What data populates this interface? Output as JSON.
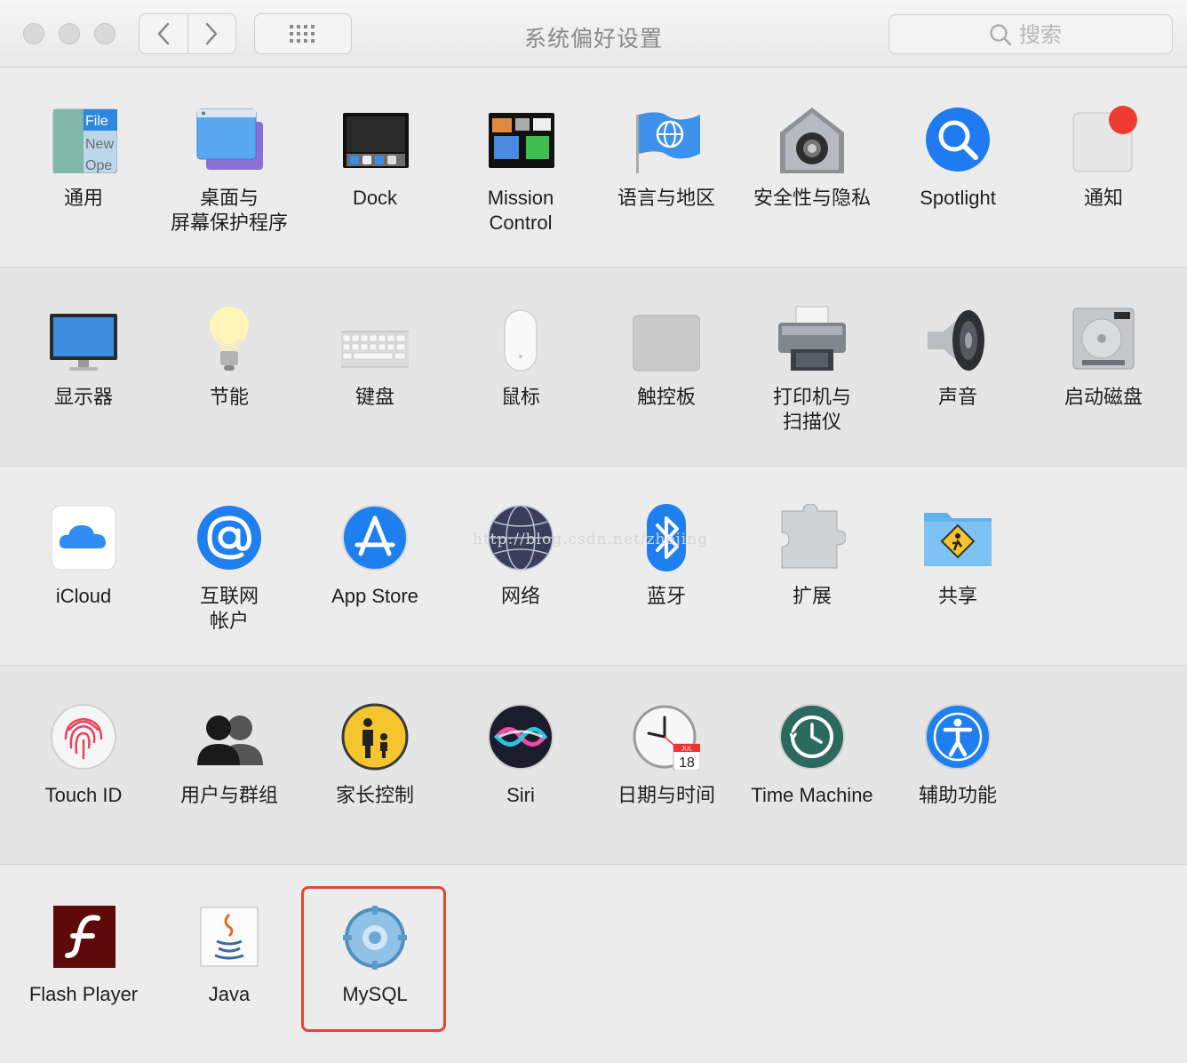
{
  "window": {
    "title": "系统偏好设置",
    "search_placeholder": "搜索"
  },
  "sections": [
    {
      "items": [
        {
          "label": "通用",
          "icon": "general-icon"
        },
        {
          "label": "桌面与\n屏幕保护程序",
          "icon": "desktop-screensaver-icon"
        },
        {
          "label": "Dock",
          "icon": "dock-icon"
        },
        {
          "label": "Mission\nControl",
          "icon": "mission-control-icon"
        },
        {
          "label": "语言与地区",
          "icon": "language-region-icon"
        },
        {
          "label": "安全性与隐私",
          "icon": "security-privacy-icon"
        },
        {
          "label": "Spotlight",
          "icon": "spotlight-icon"
        },
        {
          "label": "通知",
          "icon": "notifications-icon"
        }
      ]
    },
    {
      "items": [
        {
          "label": "显示器",
          "icon": "displays-icon"
        },
        {
          "label": "节能",
          "icon": "energy-saver-icon"
        },
        {
          "label": "键盘",
          "icon": "keyboard-icon"
        },
        {
          "label": "鼠标",
          "icon": "mouse-icon"
        },
        {
          "label": "触控板",
          "icon": "trackpad-icon"
        },
        {
          "label": "打印机与\n扫描仪",
          "icon": "printers-scanners-icon"
        },
        {
          "label": "声音",
          "icon": "sound-icon"
        },
        {
          "label": "启动磁盘",
          "icon": "startup-disk-icon"
        }
      ]
    },
    {
      "items": [
        {
          "label": "iCloud",
          "icon": "icloud-icon"
        },
        {
          "label": "互联网\n帐户",
          "icon": "internet-accounts-icon"
        },
        {
          "label": "App Store",
          "icon": "app-store-icon"
        },
        {
          "label": "网络",
          "icon": "network-icon"
        },
        {
          "label": "蓝牙",
          "icon": "bluetooth-icon"
        },
        {
          "label": "扩展",
          "icon": "extensions-icon"
        },
        {
          "label": "共享",
          "icon": "sharing-icon"
        }
      ]
    },
    {
      "items": [
        {
          "label": "Touch ID",
          "icon": "touch-id-icon"
        },
        {
          "label": "用户与群组",
          "icon": "users-groups-icon"
        },
        {
          "label": "家长控制",
          "icon": "parental-controls-icon"
        },
        {
          "label": "Siri",
          "icon": "siri-icon"
        },
        {
          "label": "日期与时间",
          "icon": "date-time-icon"
        },
        {
          "label": "Time Machine",
          "icon": "time-machine-icon"
        },
        {
          "label": "辅助功能",
          "icon": "accessibility-icon"
        }
      ]
    },
    {
      "items": [
        {
          "label": "Flash Player",
          "icon": "flash-player-icon"
        },
        {
          "label": "Java",
          "icon": "java-icon"
        },
        {
          "label": "MySQL",
          "icon": "mysql-icon"
        }
      ]
    }
  ],
  "icon_text": {
    "general": [
      "File",
      "New",
      "Ope"
    ],
    "calendar_month": "JUL",
    "calendar_day": "18"
  },
  "watermark": "http://blog.csdn.net/zhejing",
  "colors": {
    "highlight": "#e34434",
    "accent_blue": "#1e7cf0"
  }
}
